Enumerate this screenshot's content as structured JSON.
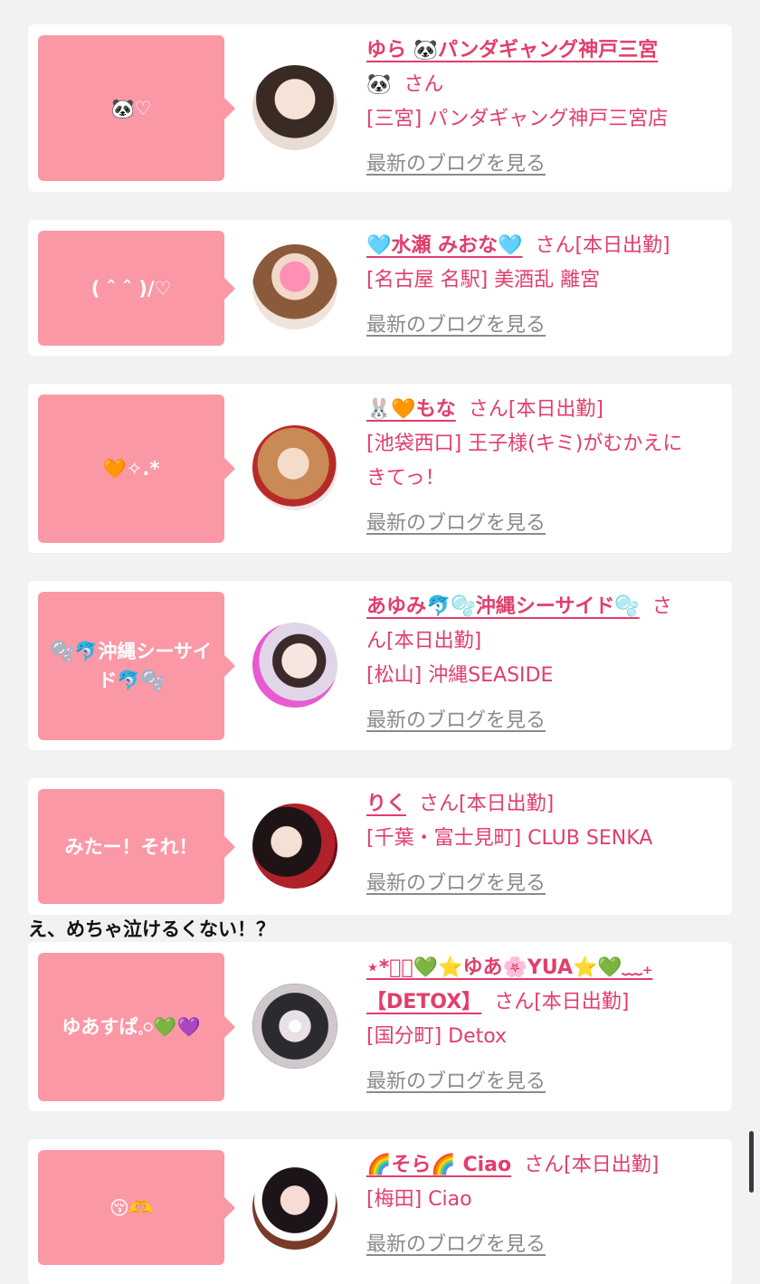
{
  "blog_link_label": "最新のブログを見る",
  "comment_text": "え、めちゃ泣けるくない！？",
  "cards": [
    {
      "bubble_text": "🐼♡",
      "name": "ゆら 🐼パンダギャング神戸三宮",
      "name_line2": "🐼",
      "san": "さん",
      "status": "",
      "shop": "[三宮] パンダギャング神戸三宮店",
      "shop2": ""
    },
    {
      "bubble_text": "( ˆ ˆ )/♡",
      "name": "🩵水瀬 みおな🩵",
      "name_line2": "",
      "san": "さん",
      "status": "[本日出勤]",
      "shop": "[名古屋 名駅] 美酒乱 離宮",
      "shop2": ""
    },
    {
      "bubble_text": "🧡✧.*",
      "name": "🐰🧡もな",
      "name_line2": "",
      "san": "さん",
      "status": "[本日出勤]",
      "shop": "[池袋西口] 王子様(キミ)がむかえに",
      "shop2": "きてっ！"
    },
    {
      "bubble_text": "🫧🐬沖縄シーサイド🐬🫧",
      "name": "あゆみ🐬🫧沖縄シーサイド🫧",
      "name_line2": "",
      "san": "さ",
      "san2": "ん",
      "status": "[本日出勤]",
      "shop": "[松山] 沖縄SEASIDE",
      "shop2": ""
    },
    {
      "bubble_text": "みたー！それ！",
      "name": "りく",
      "name_line2": "",
      "san": "さん",
      "status": "[本日出勤]",
      "shop": "[千葉・富士見町] CLUB SENKA",
      "shop2": ""
    },
    {
      "bubble_text": "ゆあすぱ𓈒𓏸💚💜",
      "name": "⋆*ﾟ﹏💚⭐️ゆあ🌸YUA⭐️💚﹏₊",
      "name_line2": "【DETOX】",
      "san": "さん",
      "status": "[本日出勤]",
      "shop": "[国分町] Detox",
      "shop2": ""
    },
    {
      "bubble_text": "😚🫶",
      "name": "🌈そら🌈 Ciao",
      "name_line2": "",
      "san": "さん",
      "status": "[本日出勤]",
      "shop": "[梅田] Ciao",
      "shop2": ""
    }
  ],
  "colors": {
    "accent": "#e33d6b",
    "bubble": "#fb98a6",
    "link_gray": "#8a8a8a",
    "background": "#f2f2f4"
  }
}
